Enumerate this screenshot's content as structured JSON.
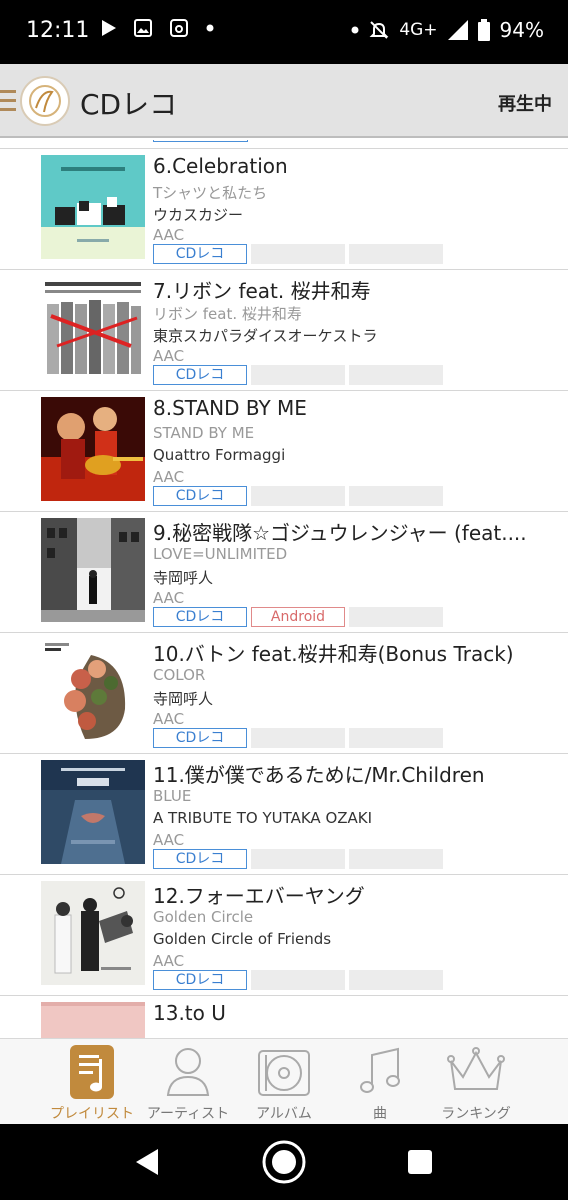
{
  "status": {
    "time": "12:11",
    "network": "4G+",
    "battery": "94%"
  },
  "app": {
    "title": "CDレコ",
    "now_playing": "再生中"
  },
  "tracks": [
    {
      "title": "6.Celebration",
      "album": "Tシャツと私たち",
      "artist": "ウカスカジー",
      "format": "AAC",
      "tags": [
        "CDレコ",
        "",
        ""
      ]
    },
    {
      "title": "7.リボン feat. 桜井和寿",
      "album": "リボン feat. 桜井和寿",
      "artist": "東京スカパラダイスオーケストラ",
      "format": "AAC",
      "tags": [
        "CDレコ",
        "",
        ""
      ]
    },
    {
      "title": "8.STAND BY ME",
      "album": "STAND BY ME",
      "artist": "Quattro Formaggi",
      "format": "AAC",
      "tags": [
        "CDレコ",
        "",
        ""
      ]
    },
    {
      "title": "9.秘密戦隊☆ゴジュウレンジャー (feat....",
      "album": "LOVE=UNLIMITED",
      "artist": "寺岡呼人",
      "format": "AAC",
      "tags": [
        "CDレコ",
        "Android",
        ""
      ]
    },
    {
      "title": "10.バトン feat.桜井和寿(Bonus Track)",
      "album": "COLOR",
      "artist": "寺岡呼人",
      "format": "AAC",
      "tags": [
        "CDレコ",
        "",
        ""
      ]
    },
    {
      "title": "11.僕が僕であるために/Mr.Children",
      "album": "BLUE",
      "artist": "A TRIBUTE TO YUTAKA OZAKI",
      "format": "AAC",
      "tags": [
        "CDレコ",
        "",
        ""
      ]
    },
    {
      "title": "12.フォーエバーヤング",
      "album": "Golden Circle",
      "artist": "Golden Circle of Friends",
      "format": "AAC",
      "tags": [
        "CDレコ",
        "",
        ""
      ]
    },
    {
      "title": "13.to U",
      "album": "",
      "artist": "",
      "format": "",
      "tags": [
        "",
        "",
        ""
      ]
    }
  ],
  "nav": [
    {
      "label": "プレイリスト",
      "icon": "playlist-icon",
      "active": true
    },
    {
      "label": "アーティスト",
      "icon": "artist-icon",
      "active": false
    },
    {
      "label": "アルバム",
      "icon": "album-icon",
      "active": false
    },
    {
      "label": "曲",
      "icon": "song-icon",
      "active": false
    },
    {
      "label": "ランキング",
      "icon": "crown-icon",
      "active": false
    }
  ],
  "colors": {
    "accent": "#c18a3d",
    "tag_blue": "#4a8fd8",
    "tag_red": "#e08a8a"
  }
}
